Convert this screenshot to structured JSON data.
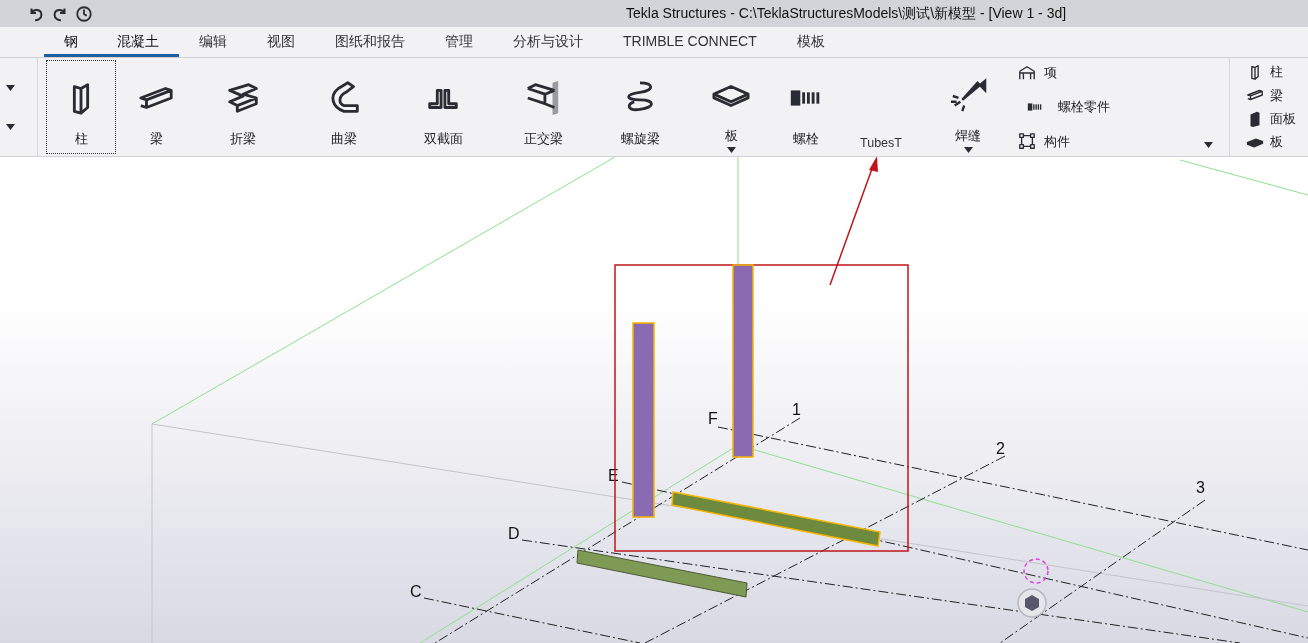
{
  "title_bar": {
    "title": "Tekla Structures - C:\\TeklaStructuresModels\\测试\\新模型  - [View 1 - 3d]"
  },
  "tabs": [
    {
      "label": "钢",
      "selected": true
    },
    {
      "label": "混凝土",
      "selected": true
    },
    {
      "label": "编辑",
      "selected": false
    },
    {
      "label": "视图",
      "selected": false
    },
    {
      "label": "图纸和报告",
      "selected": false
    },
    {
      "label": "管理",
      "selected": false
    },
    {
      "label": "分析与设计",
      "selected": false
    },
    {
      "label": "TRIMBLE CONNECT",
      "selected": false
    },
    {
      "label": "模板",
      "selected": false
    }
  ],
  "ribbon": {
    "tools": [
      {
        "kind": "column",
        "label": "柱",
        "focused": true,
        "dropdown": false
      },
      {
        "kind": "beam",
        "label": "梁",
        "focused": false,
        "dropdown": false
      },
      {
        "kind": "polybeam",
        "label": "折梁",
        "focused": false,
        "dropdown": false
      },
      {
        "kind": "curved",
        "label": "曲梁",
        "focused": false,
        "dropdown": false
      },
      {
        "kind": "twin",
        "label": "双截面",
        "focused": false,
        "dropdown": false
      },
      {
        "kind": "ortho",
        "label": "正交梁",
        "focused": false,
        "dropdown": false
      },
      {
        "kind": "spiral",
        "label": "螺旋梁",
        "focused": false,
        "dropdown": false
      },
      {
        "kind": "plate",
        "label": "板",
        "focused": false,
        "dropdown": true
      },
      {
        "kind": "bolt",
        "label": "螺栓",
        "focused": false,
        "dropdown": false
      },
      {
        "kind": "text",
        "label": "TubesT",
        "focused": false,
        "dropdown": false
      },
      {
        "kind": "weld",
        "label": "焊缝",
        "focused": false,
        "dropdown": true
      }
    ],
    "group": [
      {
        "kind": "portal",
        "label": "项"
      },
      {
        "kind": "bolt",
        "label": "螺栓零件"
      },
      {
        "kind": "component",
        "label": "构件"
      }
    ],
    "concrete": [
      {
        "kind": "column",
        "label": "柱"
      },
      {
        "kind": "beam",
        "label": "梁"
      },
      {
        "kind": "panel",
        "label": "面板"
      },
      {
        "kind": "slab",
        "label": "板"
      }
    ]
  },
  "viewport": {
    "grid_labels": [
      "F",
      "E",
      "D",
      "C",
      "1",
      "2",
      "3"
    ]
  }
}
